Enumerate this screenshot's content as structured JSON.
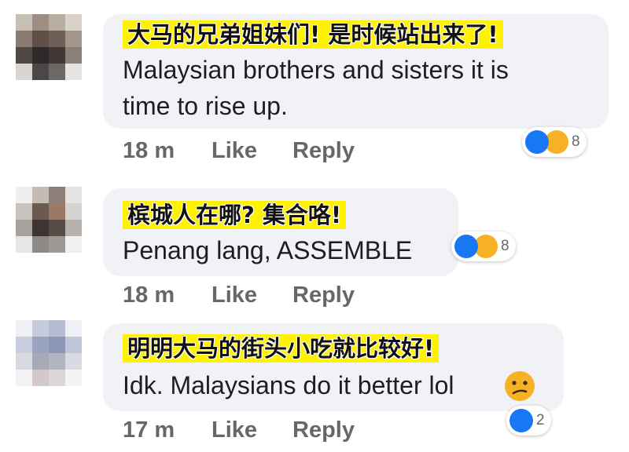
{
  "comments": [
    {
      "overlay_text": "大马的兄弟姐妹们! 是时候站出来了!",
      "lines": [
        "Malaysian brothers and sisters it is",
        "time to rise up."
      ],
      "time": "18 m",
      "like_label": "Like",
      "reply_label": "Reply",
      "reaction_count": "8",
      "reaction_icons": [
        "like-icon",
        "haha-icon"
      ]
    },
    {
      "overlay_text": "槟城人在哪? 集合咯!",
      "lines": [
        "Penang lang, ASSEMBLE"
      ],
      "time": "18 m",
      "like_label": "Like",
      "reply_label": "Reply",
      "reaction_count": "8",
      "reaction_icons": [
        "like-icon",
        "haha-icon"
      ]
    },
    {
      "overlay_text": "明明大马的街头小吃就比较好!",
      "lines": [
        "Idk. Malaysians do it better lol"
      ],
      "inline_emoji": "confused-face-icon",
      "time": "17 m",
      "like_label": "Like",
      "reply_label": "Reply",
      "reaction_count": "2",
      "reaction_icons": [
        "like-icon"
      ]
    }
  ],
  "colors": {
    "bubble": "#f0f2f5",
    "overlay_highlight": "#fff200",
    "meta_text": "#65676b",
    "like_blue": "#1877f2",
    "haha_yellow": "#f7b125"
  }
}
